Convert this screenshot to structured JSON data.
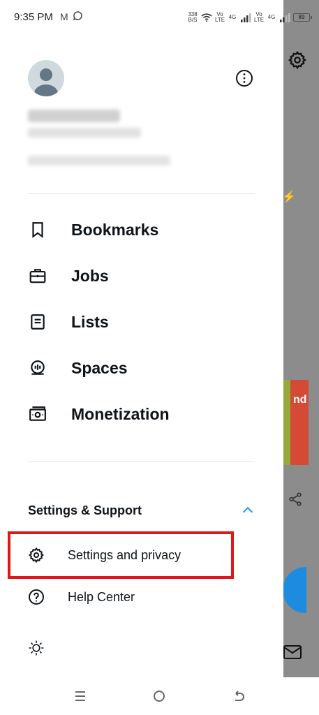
{
  "status_bar": {
    "time": "9:35 PM",
    "net_speed_value": "338",
    "net_speed_unit": "B/S",
    "sim1_label_top": "Vo",
    "sim1_label_bottom": "LTE",
    "sim1_net": "4G",
    "sim2_label_top": "Vo",
    "sim2_label_bottom": "LTE",
    "sim2_net": "4G",
    "battery": "89",
    "icons": [
      "gmail-icon",
      "whatsapp-icon",
      "wifi-icon",
      "signal-icon",
      "battery-icon"
    ]
  },
  "menu": {
    "items": [
      {
        "label": "Bookmarks",
        "icon": "bookmark-icon"
      },
      {
        "label": "Jobs",
        "icon": "briefcase-icon"
      },
      {
        "label": "Lists",
        "icon": "list-icon"
      },
      {
        "label": "Spaces",
        "icon": "spaces-icon"
      },
      {
        "label": "Monetization",
        "icon": "monetization-icon"
      }
    ]
  },
  "support": {
    "title": "Settings & Support",
    "items": [
      {
        "label": "Settings and privacy",
        "icon": "gear-icon"
      },
      {
        "label": "Help Center",
        "icon": "help-icon"
      }
    ],
    "display_icon": "sun-icon"
  },
  "background_app": {
    "card_text": "nd"
  },
  "colors": {
    "accent": "#1d9bf0",
    "highlight": "#e0161b",
    "text": "#0f1419"
  }
}
